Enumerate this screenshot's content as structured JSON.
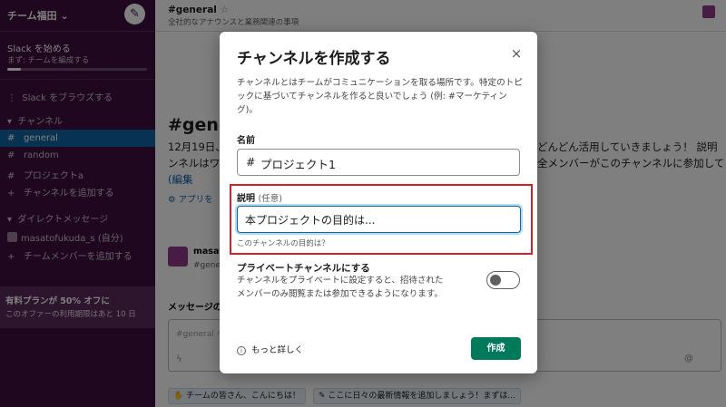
{
  "sidebar": {
    "workspace_name": "チーム福田",
    "getting_started": {
      "title": "Slack を始める",
      "subtitle": "まず: チームを編成する",
      "progress": 0.1
    },
    "browse_label": "Slack をブラウズする",
    "channels_header": "チャンネル",
    "channels": [
      "general",
      "random",
      "プロジェクトa"
    ],
    "add_channel_label": "チャンネルを追加する",
    "dm_header": "ダイレクトメッセージ",
    "dm_user": "masatofukuda_s",
    "dm_user_suffix": "(自分)",
    "add_member_label": "チームメンバーを追加する",
    "promo_title": "有料プランが 50% オフに",
    "promo_sub": "このオファーの利用期限はあと 10 日"
  },
  "main": {
    "channel_name": "#general",
    "channel_desc": "全社的なアナウンスと業務関連の事項",
    "big_heading": "#gene",
    "intro_line1": "12月19日、",
    "intro_line1_right": "どんどん活用していきましょう！ 説明",
    "intro_line2": "ンネルはワ",
    "intro_line2_right": "全メンバーがこのチャンネルに参加して",
    "edit_link": "(編集",
    "add_app": "アプリを",
    "msg_author": "masat",
    "msg_channel": "#gene",
    "messages_label": "メッセージの",
    "composer_placeholder": "#general へ",
    "chips": [
      "チームの皆さん、こんにちは！",
      "ここに日々の最新情報を追加しましょう！まずは..."
    ]
  },
  "modal": {
    "title": "チャンネルを作成する",
    "close_glyph": "×",
    "intro": "チャンネルとはチームがコミュニケーションを取る場所です。特定のトピックに基づいてチャンネルを作ると良いでしょう (例: #マーケティング)。",
    "name_label": "名前",
    "name_prefix": "#",
    "name_value": "プロジェクト1",
    "desc_label": "説明",
    "desc_optional": "(任意)",
    "desc_value": "本プロジェクトの目的は...",
    "desc_hint": "このチャンネルの目的は？",
    "private_title": "プライベートチャンネルにする",
    "private_desc": "チャンネルをプライベートに設定すると、招待されたメンバーのみ閲覧または参加できるようになります。",
    "private_enabled": false,
    "learn_more": "もっと詳しく",
    "create_label": "作成"
  },
  "colors": {
    "sidebar_bg": "#3f0e40",
    "selected_channel": "#1164a3",
    "create_button": "#007a5a",
    "highlight_box": "#d42027"
  }
}
